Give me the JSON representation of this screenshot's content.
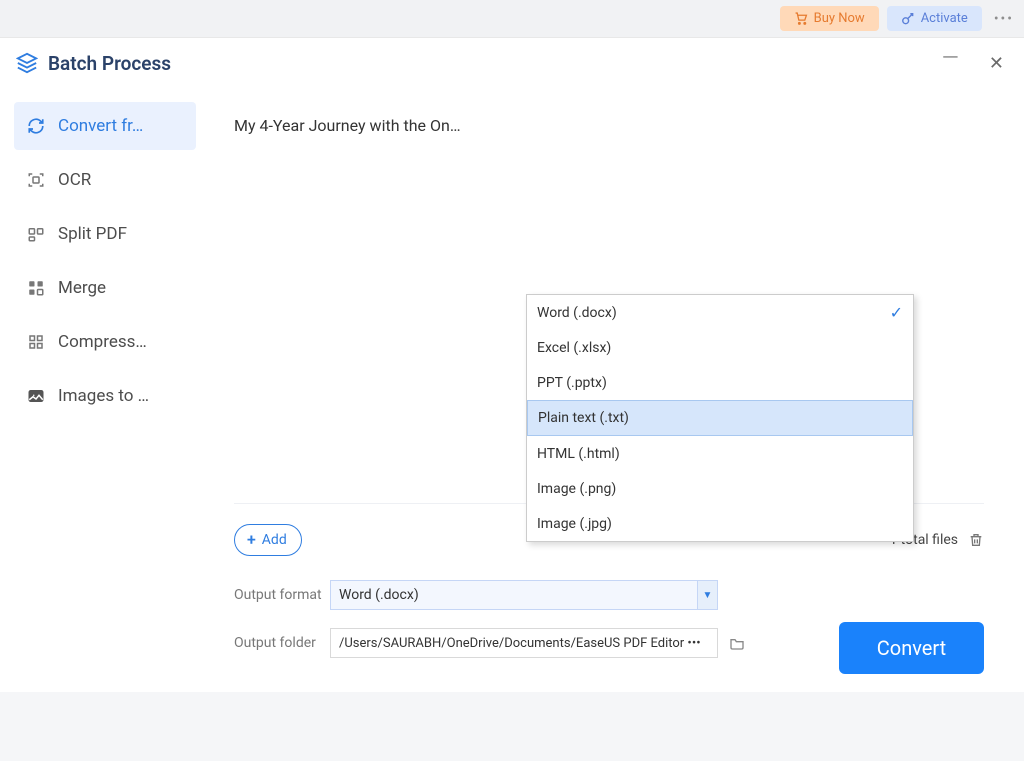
{
  "topbar": {
    "buy": "Buy Now",
    "activate": "Activate"
  },
  "window": {
    "title": "Batch Process"
  },
  "sidebar": {
    "items": [
      {
        "id": "convert",
        "label": "Convert fr…",
        "active": true
      },
      {
        "id": "ocr",
        "label": "OCR",
        "active": false
      },
      {
        "id": "split",
        "label": "Split PDF",
        "active": false
      },
      {
        "id": "merge",
        "label": "Merge",
        "active": false
      },
      {
        "id": "compress",
        "label": "Compress…",
        "active": false
      },
      {
        "id": "images",
        "label": "Images to …",
        "active": false
      }
    ]
  },
  "main": {
    "file": "My 4-Year Journey with the On…",
    "add_label": "Add",
    "count_text": "1 total files"
  },
  "form": {
    "format_label": "Output format",
    "format_value": "Word (.docx)",
    "folder_label": "Output folder",
    "folder_value": "/Users/SAURABH/OneDrive/Documents/EaseUS PDF Editor •••",
    "convert": "Convert"
  },
  "dropdown": {
    "options": [
      {
        "label": "Word (.docx)",
        "selected": true
      },
      {
        "label": "Excel (.xlsx)",
        "selected": false
      },
      {
        "label": "PPT (.pptx)",
        "selected": false
      },
      {
        "label": "Plain text (.txt)",
        "selected": false,
        "highlight": true
      },
      {
        "label": "HTML (.html)",
        "selected": false
      },
      {
        "label": "Image (.png)",
        "selected": false
      },
      {
        "label": "Image (.jpg)",
        "selected": false
      }
    ]
  }
}
